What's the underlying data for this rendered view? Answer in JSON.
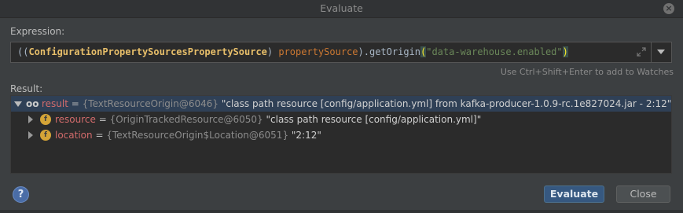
{
  "window": {
    "title": "Evaluate"
  },
  "expression": {
    "label": "Expression:",
    "tokens": {
      "open1": "((",
      "class_name": "ConfigurationPropertySourcesPropertySource",
      "close1": ")",
      "variable": "propertySource",
      "close2": ").getOrigin",
      "paren_open": "(",
      "string_arg": "\"data-warehouse.enabled\"",
      "paren_close": ")"
    },
    "hint": "Use Ctrl+Shift+Enter to add to Watches"
  },
  "result": {
    "label": "Result:",
    "rows": [
      {
        "name": "result",
        "eq": " = ",
        "type": "{TextResourceOrigin@6046}",
        "value": " \"class path resource [config/application.yml] from kafka-producer-1.0.9-rc.1e827024.jar - 2:12\""
      },
      {
        "badge": "f",
        "name": "resource",
        "eq": " = ",
        "type": "{OriginTrackedResource@6050}",
        "value": " \"class path resource [config/application.yml]\""
      },
      {
        "badge": "f",
        "name": "location",
        "eq": " = ",
        "type": "{TextResourceOrigin$Location@6051}",
        "value": " \"2:12\""
      }
    ]
  },
  "buttons": {
    "help": "?",
    "evaluate": "Evaluate",
    "close": "Close"
  },
  "icons": {
    "glasses": "oo",
    "close": "×"
  }
}
